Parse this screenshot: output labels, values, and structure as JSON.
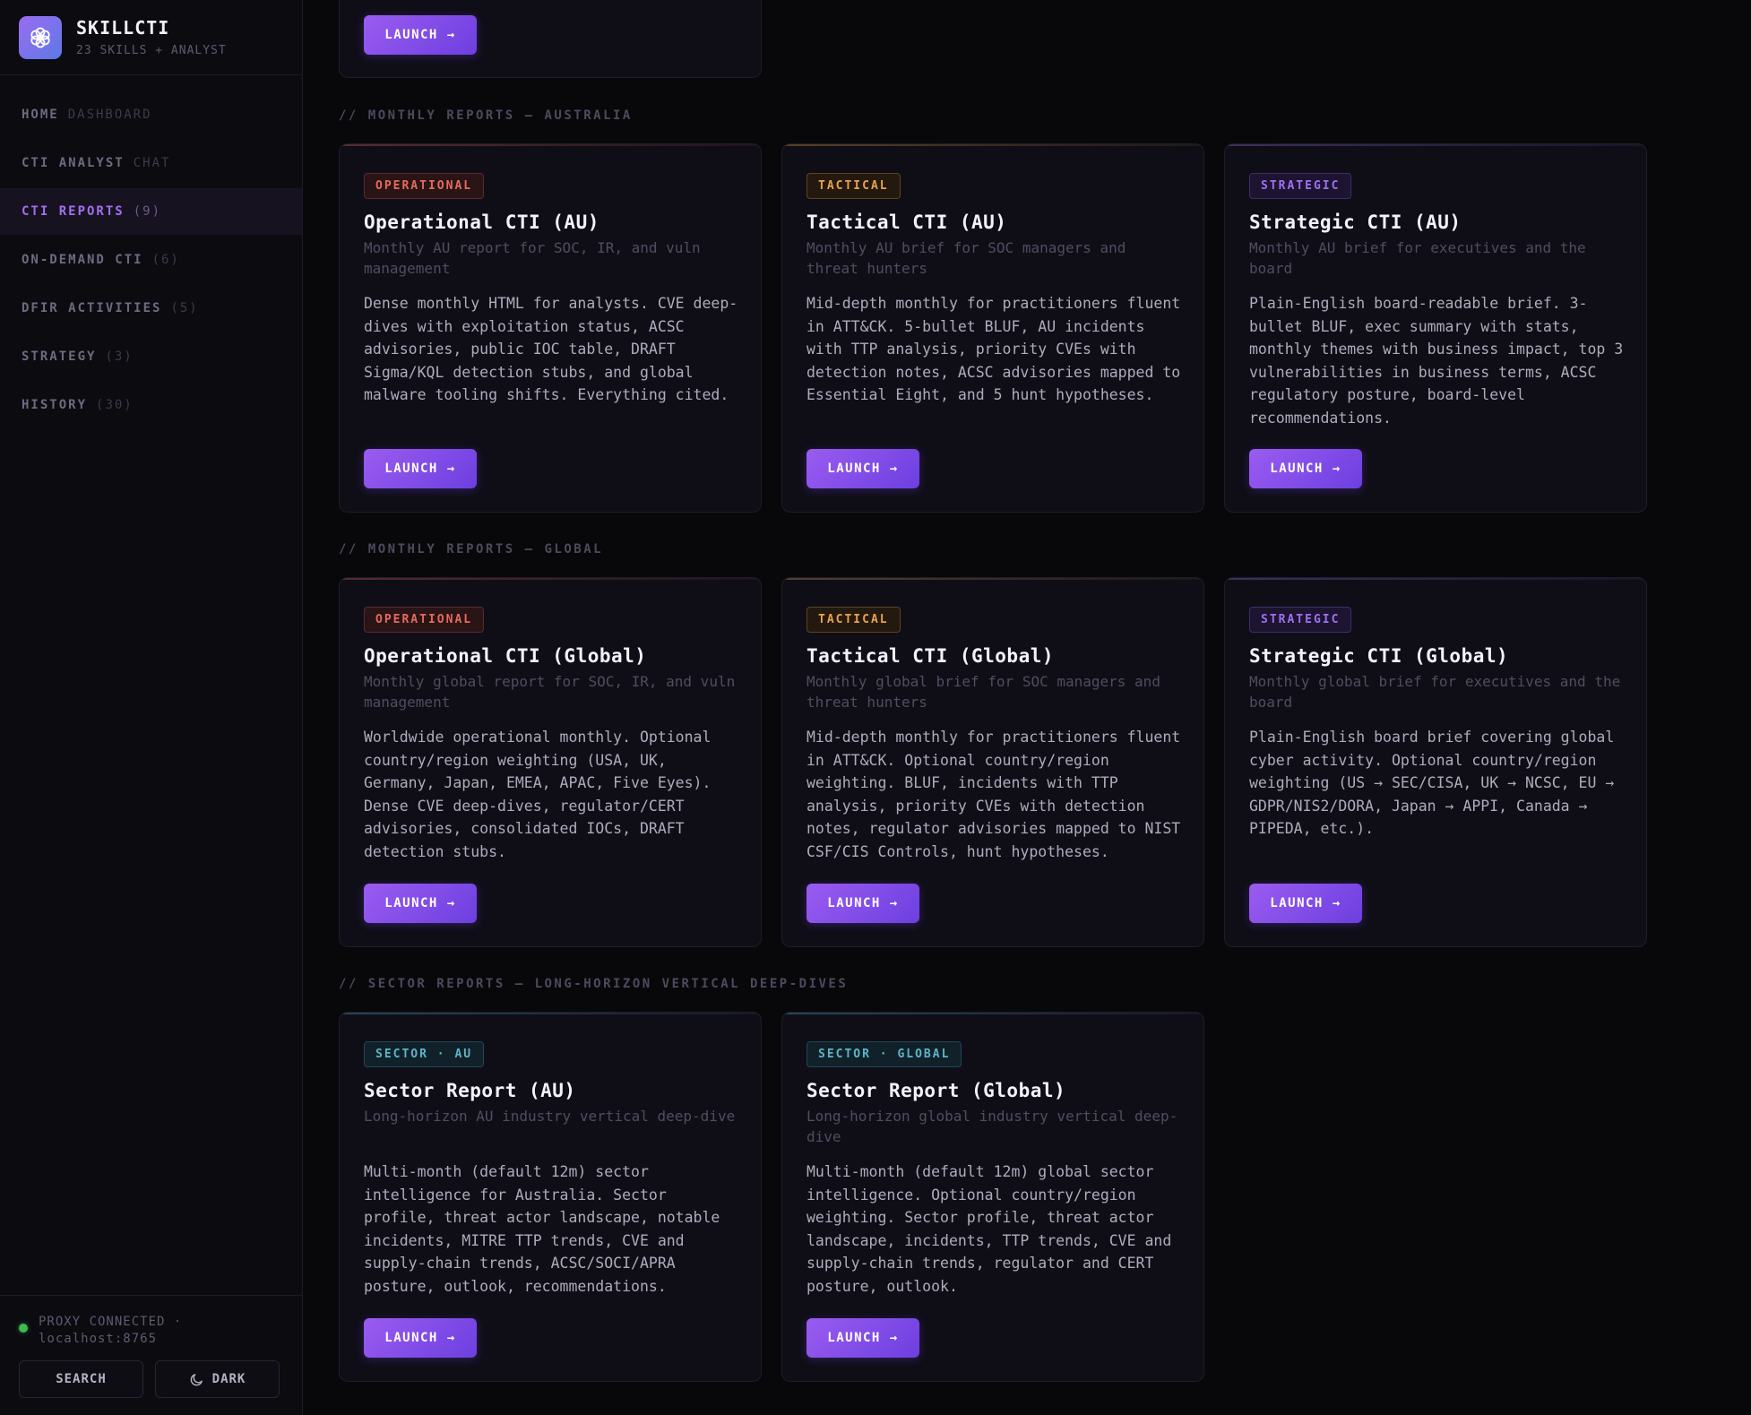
{
  "brand": {
    "title": "SKILLCTI",
    "subtitle": "23 SKILLS + ANALYST"
  },
  "nav": [
    {
      "label": "HOME",
      "extra": "DASHBOARD"
    },
    {
      "label": "CTI ANALYST",
      "extra": "CHAT"
    },
    {
      "label": "CTI REPORTS",
      "extra": "(9)"
    },
    {
      "label": "ON-DEMAND CTI",
      "extra": "(6)"
    },
    {
      "label": "DFIR ACTIVITIES",
      "extra": "(5)"
    },
    {
      "label": "STRATEGY",
      "extra": "(3)"
    },
    {
      "label": "HISTORY",
      "extra": "(30)"
    }
  ],
  "footer": {
    "status_line1": "PROXY CONNECTED ·",
    "status_line2": "localhost:8765",
    "search_label": "SEARCH",
    "theme_label": "DARK"
  },
  "launch_label": "LAUNCH →",
  "sections": {
    "au": "// MONTHLY REPORTS — AUSTRALIA",
    "global": "// MONTHLY REPORTS — GLOBAL",
    "sector": "// SECTOR REPORTS — LONG-HORIZON VERTICAL DEEP-DIVES"
  },
  "au_cards": [
    {
      "badge": "OPERATIONAL",
      "title": "Operational CTI (AU)",
      "subtitle": "Monthly AU report for SOC, IR, and vuln management",
      "description": "Dense monthly HTML for analysts. CVE deep-dives with exploitation status, ACSC advisories, public IOC table, DRAFT Sigma/KQL detection stubs, and global malware tooling shifts. Everything cited."
    },
    {
      "badge": "TACTICAL",
      "title": "Tactical CTI (AU)",
      "subtitle": "Monthly AU brief for SOC managers and threat hunters",
      "description": "Mid-depth monthly for practitioners fluent in ATT&CK. 5-bullet BLUF, AU incidents with TTP analysis, priority CVEs with detection notes, ACSC advisories mapped to Essential Eight, and 5 hunt hypotheses."
    },
    {
      "badge": "STRATEGIC",
      "title": "Strategic CTI (AU)",
      "subtitle": "Monthly AU brief for executives and the board",
      "description": "Plain-English board-readable brief. 3-bullet BLUF, exec summary with stats, monthly themes with business impact, top 3 vulnerabilities in business terms, ACSC regulatory posture, board-level recommendations."
    }
  ],
  "global_cards": [
    {
      "badge": "OPERATIONAL",
      "title": "Operational CTI (Global)",
      "subtitle": "Monthly global report for SOC, IR, and vuln management",
      "description": "Worldwide operational monthly. Optional country/region weighting (USA, UK, Germany, Japan, EMEA, APAC, Five Eyes). Dense CVE deep-dives, regulator/CERT advisories, consolidated IOCs, DRAFT detection stubs."
    },
    {
      "badge": "TACTICAL",
      "title": "Tactical CTI (Global)",
      "subtitle": "Monthly global brief for SOC managers and threat hunters",
      "description": "Mid-depth monthly for practitioners fluent in ATT&CK. Optional country/region weighting. BLUF, incidents with TTP analysis, priority CVEs with detection notes, regulator advisories mapped to NIST CSF/CIS Controls, hunt hypotheses."
    },
    {
      "badge": "STRATEGIC",
      "title": "Strategic CTI (Global)",
      "subtitle": "Monthly global brief for executives and the board",
      "description": "Plain-English board brief covering global cyber activity. Optional country/region weighting (US → SEC/CISA, UK → NCSC, EU → GDPR/NIS2/DORA, Japan → APPI, Canada → PIPEDA, etc.)."
    }
  ],
  "sector_cards": [
    {
      "badge": "SECTOR · AU",
      "title": "Sector Report (AU)",
      "subtitle": "Long-horizon AU industry vertical deep-dive",
      "description": "Multi-month (default 12m) sector intelligence for Australia. Sector profile, threat actor landscape, notable incidents, MITRE TTP trends, CVE and supply-chain trends, ACSC/SOCI/APRA posture, outlook, recommendations."
    },
    {
      "badge": "SECTOR · GLOBAL",
      "title": "Sector Report (Global)",
      "subtitle": "Long-horizon global industry vertical deep-dive",
      "description": "Multi-month (default 12m) global sector intelligence. Optional country/region weighting. Sector profile, threat actor landscape, incidents, TTP trends, CVE and supply-chain trends, regulator and CERT posture, outlook."
    }
  ],
  "colors": {
    "accent": "#9a5cf0",
    "operational": "#e46b5f",
    "tactical": "#e8a24c",
    "strategic": "#a071f0",
    "sector": "#5fb4c8",
    "status_ok": "#3fb950"
  }
}
